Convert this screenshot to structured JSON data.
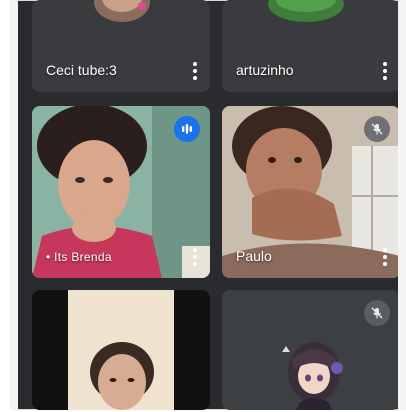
{
  "participants": [
    {
      "name": "Ceci tube:3",
      "status": "none"
    },
    {
      "name": "artuzinho",
      "status": "none"
    },
    {
      "name": "• Its Brenda",
      "status": "speaking"
    },
    {
      "name": "Paulo",
      "status": "muted"
    },
    {
      "name": "",
      "status": "none"
    },
    {
      "name": "",
      "status": "muted"
    }
  ],
  "colors": {
    "background": "#2a2b2e",
    "tile": "#3c4043",
    "speaking_accent": "#1a73e8"
  },
  "icons": {
    "more": "more-vert-icon",
    "muted": "mic-off-icon",
    "speaking": "audio-level-icon"
  }
}
